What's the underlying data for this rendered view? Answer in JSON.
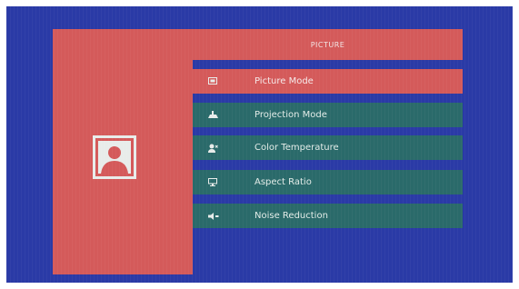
{
  "menu": {
    "title": "PICTURE",
    "items": [
      {
        "label": "Picture Mode",
        "icon": "picture-mode-icon",
        "selected": true
      },
      {
        "label": "Projection Mode",
        "icon": "projection-mode-icon",
        "selected": false
      },
      {
        "label": "Color Temperature",
        "icon": "color-temperature-icon",
        "selected": false
      },
      {
        "label": "Aspect Ratio",
        "icon": "aspect-ratio-icon",
        "selected": false
      },
      {
        "label": "Noise Reduction",
        "icon": "noise-reduction-icon",
        "selected": false
      }
    ]
  },
  "colors": {
    "background": "#2a3aa6",
    "panel": "#d45a5a",
    "item": "#2a6a6a",
    "selected": "#d45a5a"
  },
  "category_icon": "picture-category-icon"
}
